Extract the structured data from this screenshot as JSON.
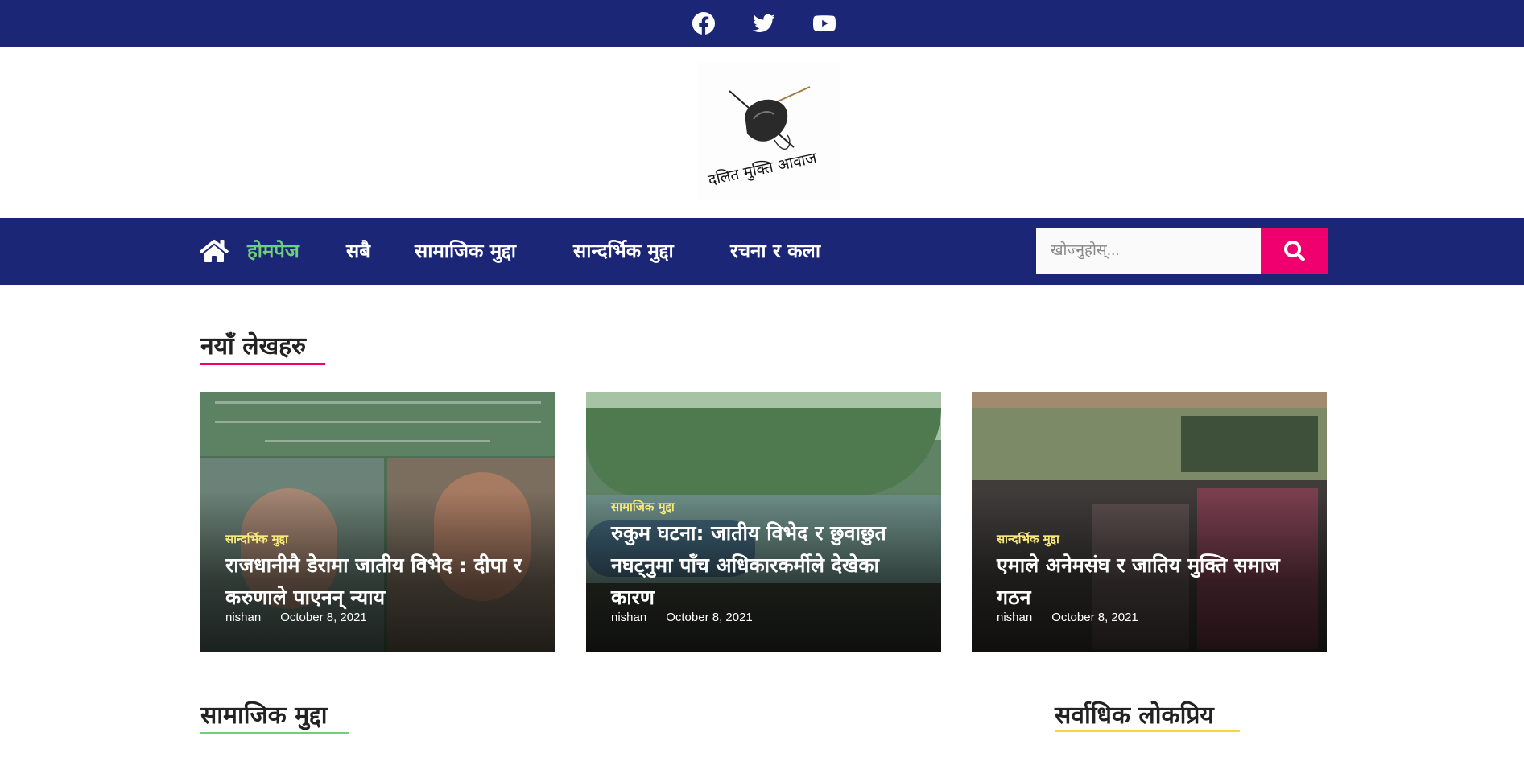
{
  "social": {
    "facebook_icon": "facebook-icon",
    "twitter_icon": "twitter-icon",
    "youtube_icon": "youtube-icon"
  },
  "logo": {
    "text": "दलित मुक्ति आवाज"
  },
  "nav": {
    "home_icon": "home-icon",
    "items": [
      "होमपेज",
      "सबै",
      "सामाजिक मुद्दा",
      "सान्दर्भिक मुद्दा",
      "रचना र कला"
    ],
    "active_index": 0
  },
  "search": {
    "placeholder": "खोज्नुहोस्...",
    "button_icon": "search-icon"
  },
  "sections": {
    "latest": "नयाँ लेखहरु",
    "social_issues": "सामाजिक मुद्दा",
    "most_popular": "सर्वाधिक लोकप्रिय"
  },
  "articles": [
    {
      "category": "सान्दर्भिक मुद्दा",
      "title": "राजधानीमै डेरामा जातीय विभेद : दीपा र करुणाले पाएनन् न्याय",
      "author": "nishan",
      "date": "October 8, 2021"
    },
    {
      "category": "सामाजिक मुद्दा",
      "title": "रुकुम घटना: जातीय विभेद र छुवाछुत नघट्नुमा पाँच अधिकारकर्मीले देखेका कारण",
      "author": "nishan",
      "date": "October 8, 2021"
    },
    {
      "category": "सान्दर्भिक मुद्दा",
      "title": "एमाले अनेमसंघ र जातिय मुक्ति समाज गठन",
      "author": "nishan",
      "date": "October 8, 2021"
    }
  ],
  "colors": {
    "brand_navy": "#1c2676",
    "accent_pink": "#f0006f",
    "active_green": "#6fd07a",
    "category_yellow": "#f7e87a",
    "popular_underline": "#f5d44a"
  }
}
